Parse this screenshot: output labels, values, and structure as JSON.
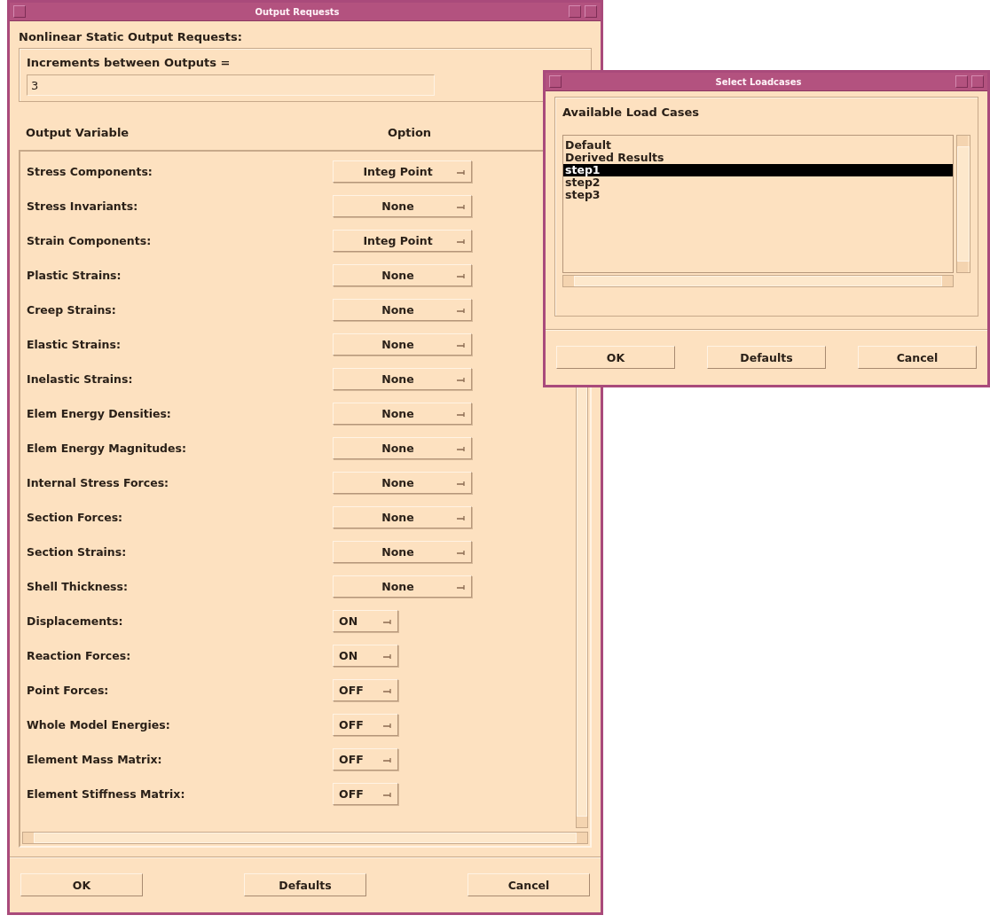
{
  "output_requests": {
    "title": "Output Requests",
    "heading": "Nonlinear Static Output Requests:",
    "increments": {
      "label": "Increments between Outputs =",
      "value": "3"
    },
    "columns": [
      "Output Variable",
      "Option"
    ],
    "rows": [
      {
        "label": "Stress Components:",
        "option": "Integ Point",
        "kind": "choice"
      },
      {
        "label": "Stress Invariants:",
        "option": "None",
        "kind": "choice"
      },
      {
        "label": "Strain Components:",
        "option": "Integ Point",
        "kind": "choice"
      },
      {
        "label": "Plastic Strains:",
        "option": "None",
        "kind": "choice"
      },
      {
        "label": "Creep Strains:",
        "option": "None",
        "kind": "choice"
      },
      {
        "label": "Elastic Strains:",
        "option": "None",
        "kind": "choice"
      },
      {
        "label": "Inelastic Strains:",
        "option": "None",
        "kind": "choice"
      },
      {
        "label": "Elem Energy Densities:",
        "option": "None",
        "kind": "choice"
      },
      {
        "label": "Elem Energy Magnitudes:",
        "option": "None",
        "kind": "choice"
      },
      {
        "label": "Internal Stress Forces:",
        "option": "None",
        "kind": "choice"
      },
      {
        "label": "Section Forces:",
        "option": "None",
        "kind": "choice"
      },
      {
        "label": "Section Strains:",
        "option": "None",
        "kind": "choice"
      },
      {
        "label": "Shell Thickness:",
        "option": "None",
        "kind": "choice"
      },
      {
        "label": "Displacements:",
        "option": "ON",
        "kind": "toggle"
      },
      {
        "label": "Reaction Forces:",
        "option": "ON",
        "kind": "toggle"
      },
      {
        "label": "Point Forces:",
        "option": "OFF",
        "kind": "toggle"
      },
      {
        "label": "Whole Model Energies:",
        "option": "OFF",
        "kind": "toggle"
      },
      {
        "label": "Element Mass Matrix:",
        "option": "OFF",
        "kind": "toggle"
      },
      {
        "label": "Element Stiffness Matrix:",
        "option": "OFF",
        "kind": "toggle"
      }
    ],
    "buttons": [
      "OK",
      "Defaults",
      "Cancel"
    ]
  },
  "select_loadcases": {
    "title": "Select Loadcases",
    "label": "Available Load Cases",
    "items": [
      {
        "label": "Default",
        "selected": false
      },
      {
        "label": "Derived Results",
        "selected": false
      },
      {
        "label": "step1",
        "selected": true
      },
      {
        "label": "step2",
        "selected": false
      },
      {
        "label": "step3",
        "selected": false
      }
    ],
    "buttons": [
      "OK",
      "Defaults",
      "Cancel"
    ]
  }
}
